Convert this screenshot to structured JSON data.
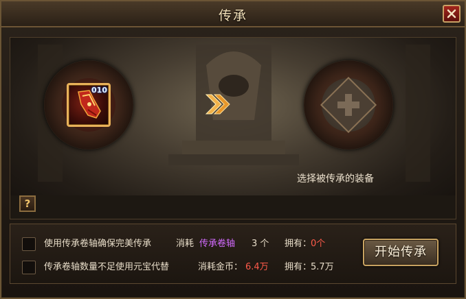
{
  "window": {
    "title": "传承"
  },
  "source_slot": {
    "item_icon": "gauntlet-icon",
    "item_count": "010"
  },
  "target_slot": {
    "icon": "plus-icon",
    "hint": "选择被传承的装备"
  },
  "help_button": {
    "label": "?"
  },
  "options": [
    {
      "label": "使用传承卷轴确保完美传承",
      "cost_prefix": "消耗",
      "cost_item": "传承卷轴",
      "cost_qty": "3 个",
      "own_label": "拥有：",
      "own_value": "0个"
    },
    {
      "label": "传承卷轴数量不足使用元宝代替",
      "cost_prefix": "消耗金币：",
      "cost_value": "6.4万",
      "own_label": "拥有：",
      "own_value": "5.7万"
    }
  ],
  "start_button": {
    "label": "开始传承"
  },
  "colors": {
    "accent_gold": "#c9a462",
    "cost_purple": "#d36bff",
    "cost_red": "#ff5a4a"
  }
}
